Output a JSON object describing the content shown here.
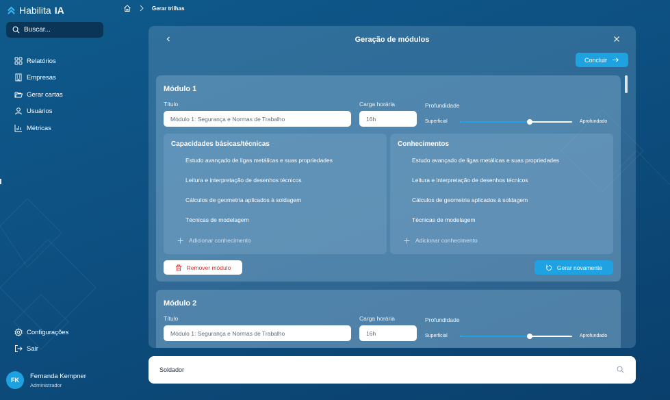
{
  "app": {
    "name_prefix": "Habilita",
    "name_suffix": "IA"
  },
  "search": {
    "label": "Buscar..."
  },
  "nav": [
    {
      "label": "Relatórios",
      "icon": "grid-icon"
    },
    {
      "label": "Empresas",
      "icon": "building-icon"
    },
    {
      "label": "Gerar cartas",
      "icon": "folder-icon"
    },
    {
      "label": "Usuários",
      "icon": "user-icon"
    },
    {
      "label": "Métricas",
      "icon": "bar-chart-icon"
    }
  ],
  "bottom_nav": [
    {
      "label": "Configurações",
      "icon": "gear-icon"
    },
    {
      "label": "Sair",
      "icon": "logout-icon"
    }
  ],
  "user": {
    "initials": "FK",
    "name": "Fernanda Kempner",
    "role": "Administrador"
  },
  "breadcrumb": {
    "current": "Gerar trilhas"
  },
  "panel": {
    "title": "Geração de módulos",
    "conclude_label": "Concluir"
  },
  "labels": {
    "title_field": "Título",
    "hours_field": "Carga horária",
    "depth": "Profundidade",
    "depth_min": "Superficial",
    "depth_max": "Aprofundado"
  },
  "modules": [
    {
      "heading": "Módulo 1",
      "title_value": "Módulo 1: Segurança e Normas de Trabalho",
      "hours": "16h",
      "depth_level": 0.62,
      "capacidades": {
        "heading": "Capacidades básicas/técnicas",
        "items": [
          "Estudo avançado de ligas metálicas e suas propriedades",
          "Leitura e interpretação de desenhos técnicos",
          "Cálculos de geometria aplicados à soldagem",
          "Técnicas de modelagem"
        ],
        "add_label": "Adicionar conhecimento"
      },
      "conhecimentos": {
        "heading": "Conhecimentos",
        "items": [
          "Estudo avançado de ligas metálicas e suas propriedades",
          "Leitura e interpretação de desenhos técnicos",
          "Cálculos de geometria aplicados à soldagem",
          "Técnicas de modelagem"
        ],
        "add_label": "Adicionar conhecimento"
      },
      "remove_label": "Remover módulo",
      "regen_label": "Gerar novamente"
    },
    {
      "heading": "Módulo 2",
      "title_value": "Módulo 1: Segurança e Normas de Trabalho",
      "hours": "16h",
      "depth_level": 0.62
    }
  ],
  "bottom_search": {
    "value": "Soldador"
  },
  "colors": {
    "accent": "#1ea2e2",
    "danger": "#d0342c",
    "bg": "#0d4f80"
  }
}
